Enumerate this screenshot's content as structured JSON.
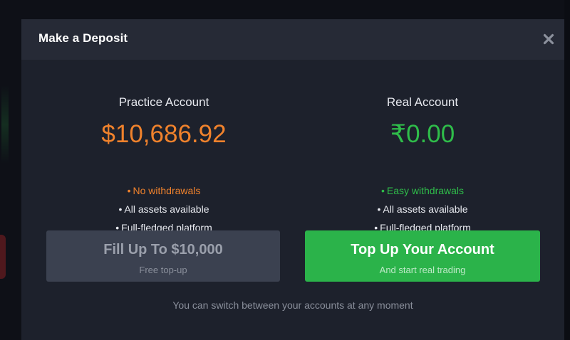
{
  "modal": {
    "title": "Make a Deposit",
    "close_icon": "close-icon"
  },
  "practice": {
    "name": "Practice Account",
    "balance": "$10,686.92",
    "balance_color": "#f0822c",
    "features": [
      {
        "bullet": "•",
        "text": "No withdrawals",
        "color": "#f0822c"
      },
      {
        "bullet": "•",
        "text": "All assets available",
        "color": "#e8eaf0"
      },
      {
        "bullet": "•",
        "text": "Full-fledged platform",
        "color": "#e8eaf0"
      }
    ],
    "button": {
      "label": "Fill Up To $10,000",
      "sublabel": "Free top-up",
      "color": "#3b4150"
    }
  },
  "real": {
    "name": "Real Account",
    "balance": "₹0.00",
    "balance_color": "#2fbd4a",
    "features": [
      {
        "bullet": "•",
        "text": "Easy withdrawals",
        "color": "#2fbd4a"
      },
      {
        "bullet": "•",
        "text": "All assets available",
        "color": "#e8eaf0"
      },
      {
        "bullet": "•",
        "text": "Full-fledged platform",
        "color": "#e8eaf0"
      }
    ],
    "button": {
      "label": "Top Up Your Account",
      "sublabel": "And start real trading",
      "color": "#2bb34a"
    }
  },
  "footnote": "You can switch between your accounts at any moment",
  "theme": {
    "modal_bg": "#1d212c",
    "header_bg": "#262a36",
    "accent_orange": "#f0822c",
    "accent_green": "#2fbd4a"
  }
}
